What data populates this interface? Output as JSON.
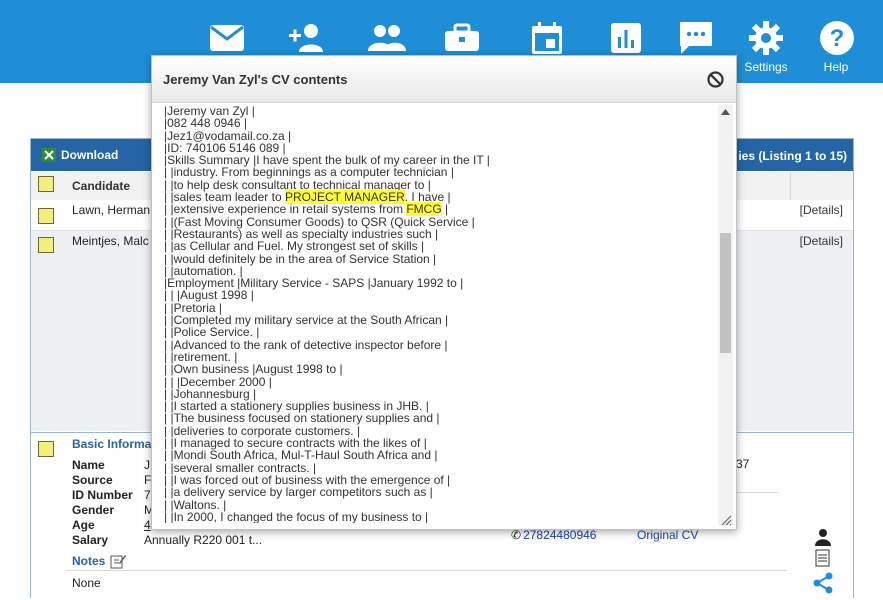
{
  "nav": {
    "settings_label": "Settings",
    "help_label": "Help"
  },
  "panel": {
    "download_label": "Download",
    "listing_text": "ies (Listing 1 to 15)",
    "column_candidate": "Candidate",
    "rows": [
      {
        "name": "Lawn, Herman",
        "details": "[Details]"
      },
      {
        "name": "Meintjes, Malc",
        "details": "[Details]"
      }
    ]
  },
  "info": {
    "title": "Basic Informa",
    "labels": [
      "Name",
      "Source",
      "ID Number",
      "Gender",
      "Age",
      "Salary"
    ],
    "values": [
      "J",
      "F",
      "7",
      "M",
      "4",
      "Annually R220 001 t..."
    ],
    "notes_label": "Notes",
    "notes_value": "None",
    "right_number": "37",
    "phone": "27824480946",
    "original_cv": "Original CV"
  },
  "modal": {
    "title": "Jeremy Van Zyl's CV contents",
    "lines": [
      "|Jeremy van Zyl |",
      "|082 448 0946 |",
      "|Jez1@vodamail.co.za |",
      "|ID: 740106 5146 089 |",
      "|Skills Summary |I have spent the bulk of my career in the IT |",
      "| |industry. From beginnings as a computer technician |",
      "| |to help desk consultant to technical manager to |",
      "| |sales team leader to ",
      "| |extensive experience in retail systems from ",
      "| |(Fast Moving Consumer Goods) to QSR (Quick Service |",
      "| |Restaurants) as well as specialty industries such |",
      "| |as Cellular and Fuel. My strongest set of skills |",
      "| |would definitely be in the area of Service Station |",
      "| |automation. |",
      "|Employment |Military Service - SAPS |January 1992 to |",
      "| | |August 1998 |",
      "| |Pretoria |",
      "| |Completed my military service at the South African |",
      "| |Police Service. |",
      "| |Advanced to the rank of detective inspector before |",
      "| |retirement. |",
      "| |Own business |August 1998 to |",
      "| | |December 2000 |",
      "| |Johannesburg |",
      "| |I started a stationery supplies business in JHB. |",
      "| |The business focused on stationery supplies and |",
      "| |deliveries to corporate customers. |",
      "| |I managed to secure contracts with the likes of |",
      "| |Mondi South Africa, Mul-T-Haul South Africa and |",
      "| |several smaller contracts. |",
      "| |I was forced out of business with the emergence of |",
      "| |a delivery service by larger competitors such as |",
      "| |Waltons. |",
      "| |In 2000, I changed the focus of my business to |"
    ],
    "hl1": "PROJECT MANAGER",
    "hl1_after": ". I have |",
    "hl2": "FMCG",
    "hl2_after": " |"
  },
  "colors": {
    "topbar": "#1e8fd6",
    "panel_header": "#2565a5",
    "checkbox": "#f2ef7c",
    "highlight": "#ffff33"
  }
}
